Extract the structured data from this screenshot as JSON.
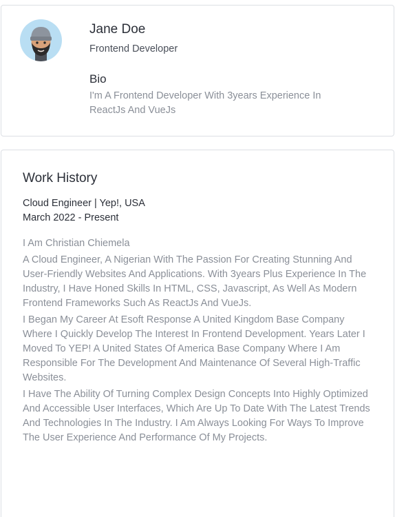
{
  "profile": {
    "avatar_icon": "memoji-avatar-icon",
    "name": "Jane Doe",
    "role": "Frontend Developer",
    "bio_title": "Bio",
    "bio_text": "I'm A Frontend Developer With 3years Experience In ReactJs And VueJs"
  },
  "work_history": {
    "title": "Work History",
    "job_title": "Cloud Engineer | Yep!, USA",
    "job_dates": "March 2022 - Present",
    "paragraphs": [
      "I Am Christian Chiemela",
      "A Cloud Engineer, A Nigerian With The Passion For Creating Stunning And User-Friendly Websites And Applications. With 3years Plus Experience In The Industry, I Have Honed Skills In HTML, CSS, Javascript, As Well As Modern Frontend Frameworks Such As ReactJs And VueJs.",
      "I Began My Career At Esoft Response A United Kingdom Base Company Where I Quickly Develop The Interest In Frontend Development. Years Later I Moved To YEP! A United States Of America Base Company Where I Am Responsible For The Development And Maintenance Of Several High-Traffic Websites.",
      "I Have The Ability Of Turning Complex Design Concepts Into Highly Optimized And Accessible User Interfaces, Which Are Up To Date With The Latest Trends And Technologies In The Industry. I Am Always Looking For Ways To Improve The User Experience And Performance Of My Projects."
    ]
  },
  "colors": {
    "avatar_bg": "#b9def3",
    "border": "#dcdfe4",
    "heading": "#2b2f38",
    "muted": "#8a8f98"
  }
}
